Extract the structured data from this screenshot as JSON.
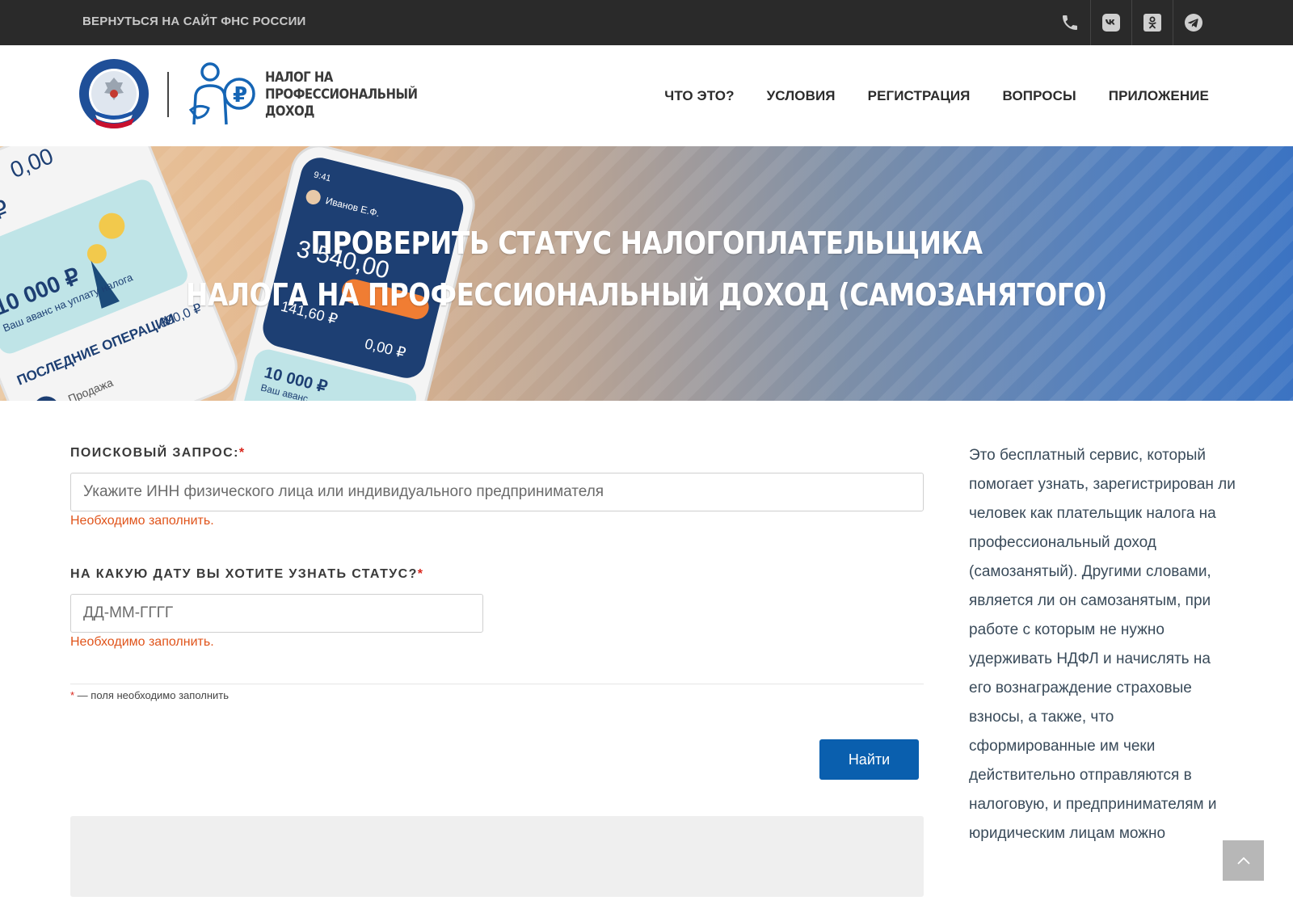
{
  "topbar": {
    "back_link": "ВЕРНУТЬСЯ НА САЙТ ФНС РОССИИ",
    "icons": [
      "phone-icon",
      "vk-icon",
      "ok-icon",
      "telegram-icon"
    ]
  },
  "header": {
    "logo_text_line1": "НАЛОГ НА",
    "logo_text_line2": "ПРОФЕССИОНАЛЬНЫЙ",
    "logo_text_line3": "ДОХОД",
    "nav": [
      "ЧТО ЭТО?",
      "УСЛОВИЯ",
      "РЕГИСТРАЦИЯ",
      "ВОПРОСЫ",
      "ПРИЛОЖЕНИЕ"
    ]
  },
  "hero": {
    "title_line1": "ПРОВЕРИТЬ СТАТУС НАЛОГОПЛАТЕЛЬЩИКА",
    "title_line2": "НАЛОГА НА ПРОФЕССИОНАЛЬНЫЙ ДОХОД (САМОЗАНЯТОГО)",
    "phone": {
      "amount_left_top": "0,00",
      "amount_left_partial": ",60 ₽",
      "amount_left_main": "10 000 ₽",
      "advance_caption": "Ваш аванс на уплату налога",
      "recent_ops": "ПОСЛЕДНИЕ ОПЕРАЦИИ",
      "op_sale": "Продажа",
      "op_value": "890,0 ₽",
      "right_user": "Иванов Е.Ф.",
      "right_time": "9:41",
      "right_amount": "3 540,00",
      "right_tax": "141,60 ₽",
      "right_debt": "0,00 ₽",
      "right_bottom_amount": "10 000 ₽",
      "right_bottom_caption": "Ваш аванс"
    }
  },
  "form": {
    "query_label": "ПОИСКОВЫЙ ЗАПРОС:",
    "required_mark": "*",
    "query_placeholder": "Укажите ИНН физического лица или индивидуального предпринимателя",
    "query_error": "Необходимо заполнить.",
    "date_label": "НА КАКУЮ ДАТУ ВЫ ХОТИТЕ УЗНАТЬ СТАТУС?",
    "date_placeholder": "ДД-ММ-ГГГГ",
    "date_error": "Необходимо заполнить.",
    "note": " — поля необходимо заполнить",
    "submit_label": "Найти"
  },
  "sidebar": {
    "text": "Это бесплатный сервис, который помогает узнать, зарегистрирован ли человек как плательщик налога на профессиональный доход (самозанятый). Другими словами, является ли он самозанятым, при работе с которым не нужно удерживать НДФЛ и начислять на его вознаграждение страховые взносы, а также, что сформированные им чеки действительно отправляются в налоговую, и предпринимателям и юридическим лицам можно"
  },
  "colors": {
    "topbar_bg": "#2a2a2a",
    "button_blue": "#0a5fae",
    "error_orange": "#e0541b",
    "required_red": "#d9261c"
  }
}
